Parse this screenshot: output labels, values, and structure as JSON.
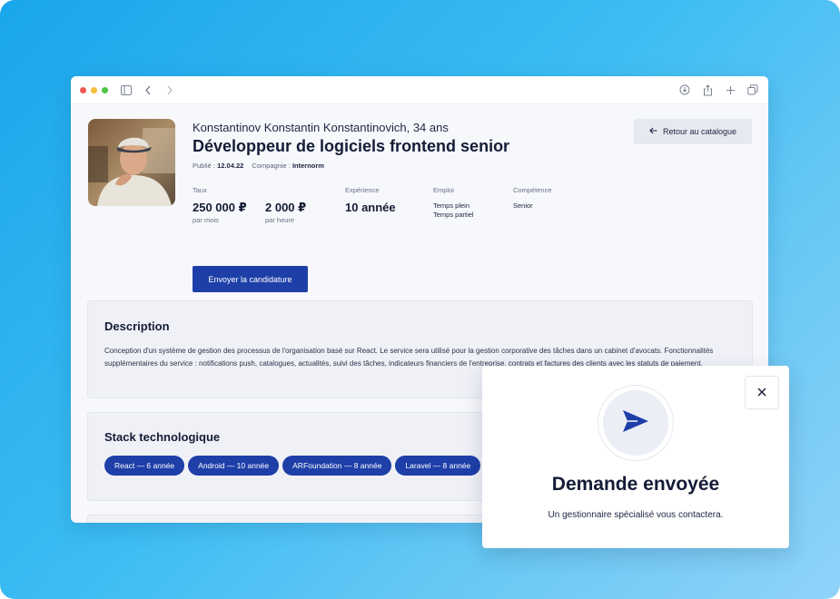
{
  "candidate": {
    "name_age": "Konstantinov Konstantin Konstantinovich, 34 ans",
    "job_title": "Développeur de logiciels frontend senior",
    "published_label": "Publié :",
    "published_date": "12.04.22",
    "company_label": "Compagnie :",
    "company": "Internorm"
  },
  "back_button": {
    "label": "Retour au catalogue"
  },
  "stats": {
    "rate_label": "Taux",
    "monthly_rate": "250 000 ₽",
    "monthly_unit": "par mois",
    "hourly_rate": "2 000 ₽",
    "hourly_unit": "par heure",
    "experience_label": "Expérience",
    "experience_value": "10 année",
    "employment_label": "Emploi",
    "employment_values": [
      "Temps plein",
      "Temps partiel"
    ],
    "skill_label": "Compétence",
    "skill_value": "Senior"
  },
  "apply_button": {
    "label": "Envoyer la candidature"
  },
  "description": {
    "title": "Description",
    "text": "Conception d'un système de gestion des processus de l'organisation basé sur React. Le service sera utilisé pour la gestion corporative des tâches dans un cabinet d'avocats. Fonctionnalités supplémentaires du service : notifications push, catalogues, actualités, suivi des tâches, indicateurs financiers de l'entreprise, contrats et factures des clients avec les statuts de paiement."
  },
  "stack": {
    "title": "Stack technologique",
    "chips": [
      "React — 6 année",
      "Android — 10 année",
      "ARFoundation — 8 année",
      "Laravel — 8 année"
    ]
  },
  "modal": {
    "title": "Demande envoyée",
    "subtitle": "Un gestionnaire spécialisé vous contactera."
  },
  "colors": {
    "accent": "#1e3fa8",
    "background_gradient_start": "#1aa6ec",
    "background_gradient_end": "#8fd3f8"
  },
  "icons": {
    "titlebar_left": [
      "sidebar-icon",
      "chevron-left-icon",
      "chevron-right-icon"
    ],
    "titlebar_right": [
      "download-icon",
      "share-icon",
      "plus-icon",
      "tabs-icon"
    ],
    "modal": [
      "close-icon",
      "paper-plane-icon"
    ],
    "back": "arrow-left-icon"
  }
}
